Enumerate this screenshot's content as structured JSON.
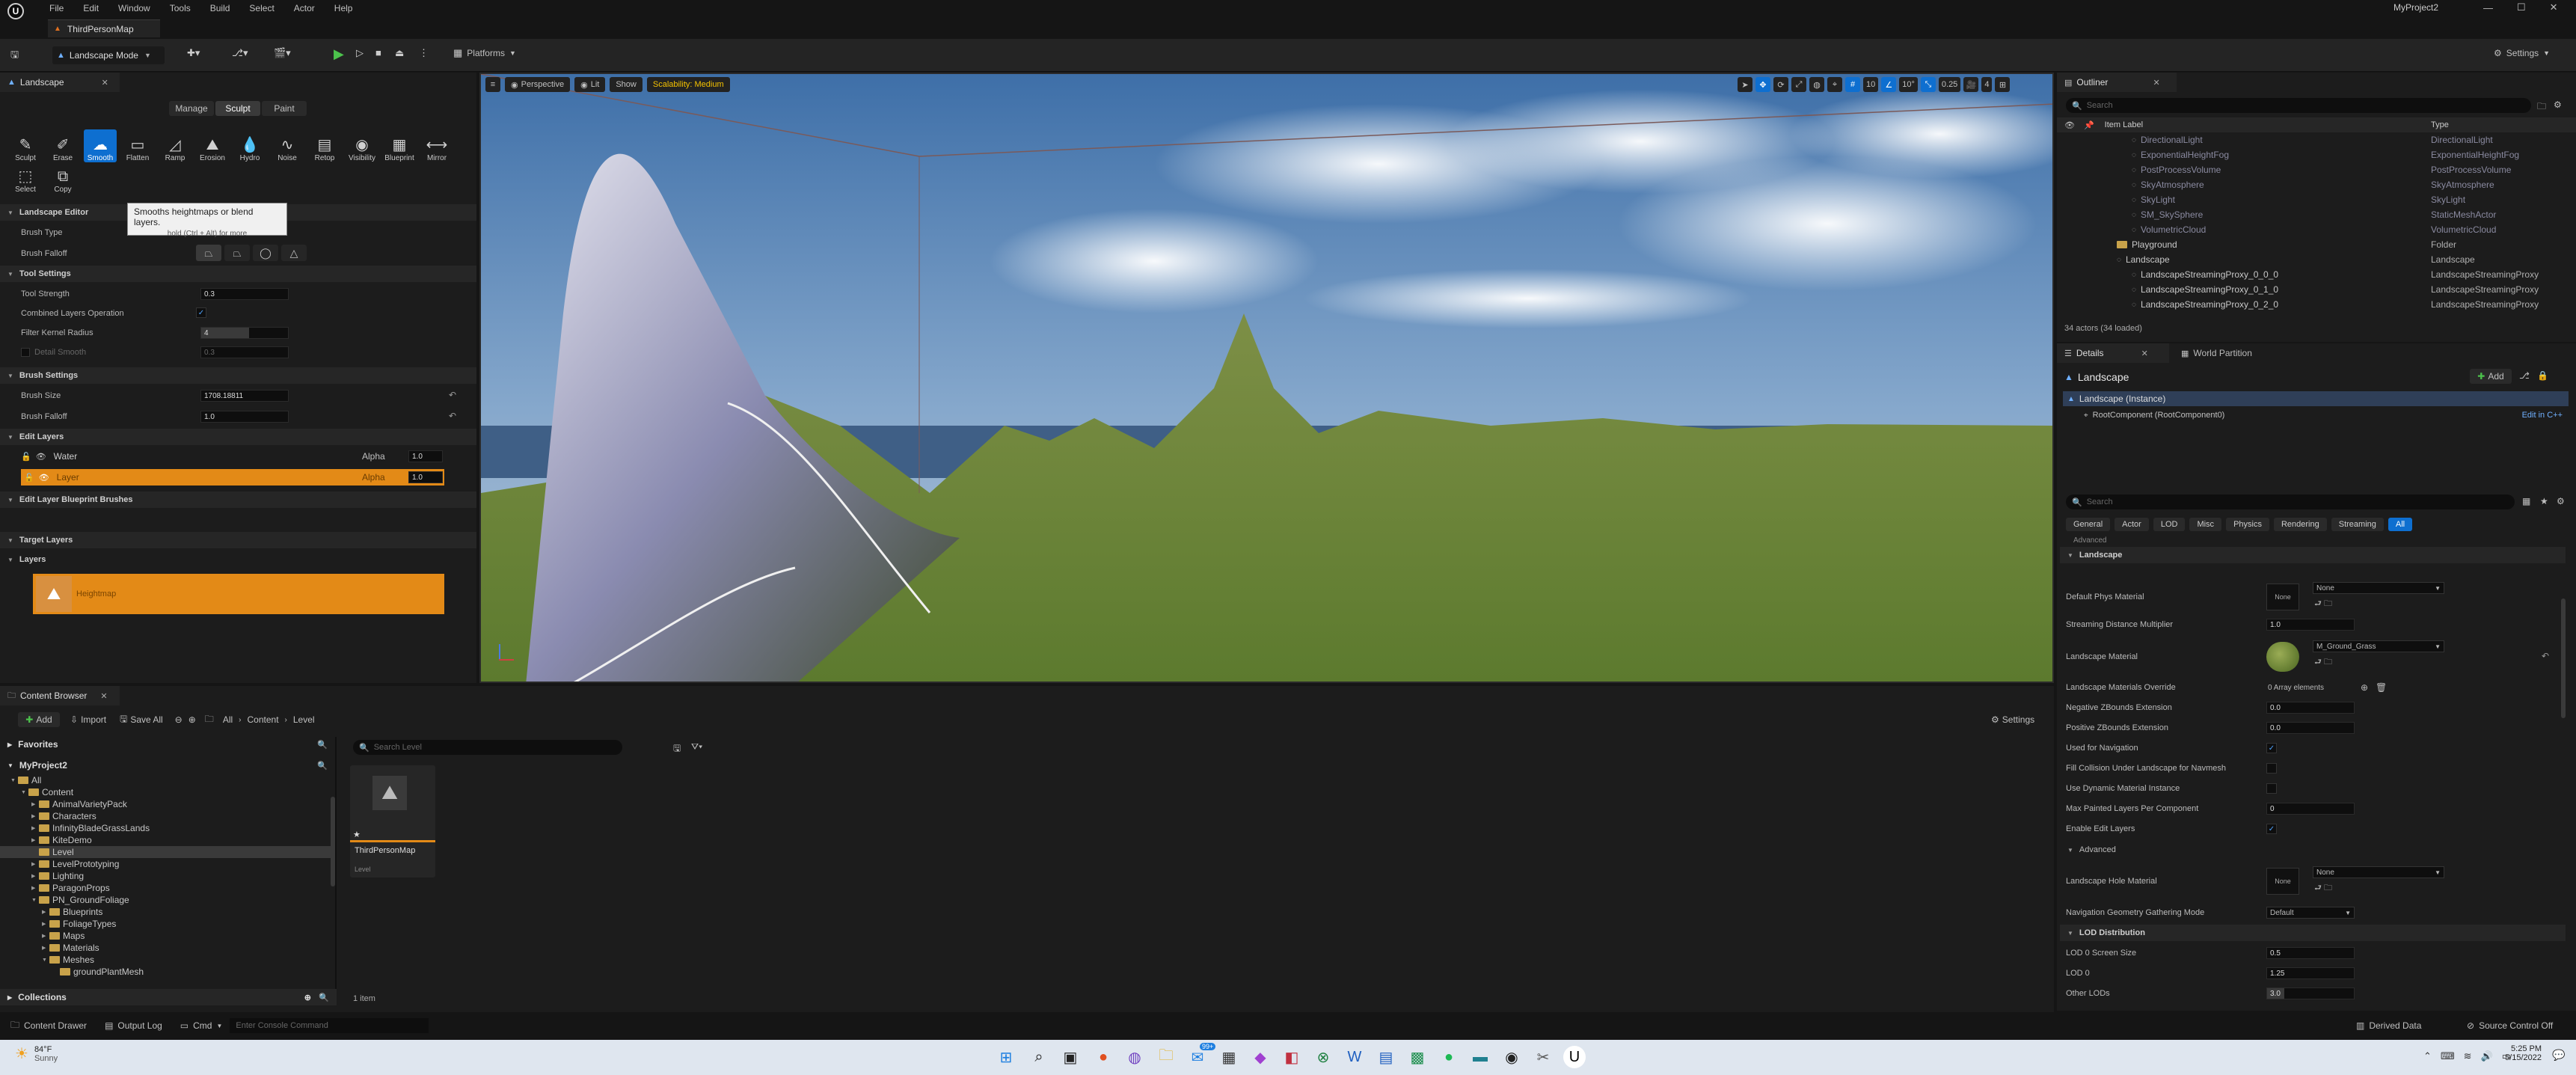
{
  "menu": {
    "items": [
      "File",
      "Edit",
      "Window",
      "Tools",
      "Build",
      "Select",
      "Actor",
      "Help"
    ],
    "project": "MyProject2"
  },
  "tab": {
    "level": "ThirdPersonMap"
  },
  "toolbar": {
    "mode": "Landscape Mode",
    "platforms": "Platforms",
    "settings": "Settings"
  },
  "landscape_panel": {
    "title": "Landscape",
    "modes": [
      "Manage",
      "Sculpt",
      "Paint"
    ],
    "tools": [
      "Sculpt",
      "Erase",
      "Smooth",
      "Flatten",
      "Ramp",
      "Erosion",
      "Hydro",
      "Noise",
      "Retop",
      "Visibility",
      "Blueprint",
      "Mirror",
      "Select",
      "Copy"
    ],
    "tooltip_title": "Smooths heightmaps or blend layers.",
    "tooltip_hint": "hold (Ctrl + Alt) for more",
    "sections": {
      "editor": "Landscape Editor",
      "brush_type": "Brush Type",
      "brush_falloff": "Brush Falloff",
      "tool_settings": "Tool Settings",
      "tool_strength": "Tool Strength",
      "tool_strength_val": "0.3",
      "combined": "Combined Layers Operation",
      "filter": "Filter Kernel Radius",
      "filter_val": "4",
      "detail": "Detail Smooth",
      "detail_val": "0.3",
      "brush_settings": "Brush Settings",
      "brush_size": "Brush Size",
      "brush_size_val": "1708.18811",
      "brush_falloff2": "Brush Falloff",
      "brush_falloff_val": "1.0",
      "edit_layers": "Edit Layers",
      "layer1": "Water",
      "layer1_alpha": "Alpha",
      "layer1_val": "1.0",
      "layer2": "Layer",
      "layer2_alpha": "Alpha",
      "layer2_val": "1.0",
      "bp_brushes": "Edit Layer Blueprint Brushes",
      "target_layers": "Target Layers",
      "layers": "Layers",
      "heightmap": "Heightmap"
    }
  },
  "viewport": {
    "perspective": "Perspective",
    "lit": "Lit",
    "show": "Show",
    "scalability": "Scalability: Medium",
    "grid": "10",
    "angle": "10°",
    "scale": "0.25",
    "cam": "4"
  },
  "outliner": {
    "title": "Outliner",
    "search": "Search",
    "col_label": "Item Label",
    "col_type": "Type",
    "rows": [
      {
        "label": "DirectionalLight",
        "type": "DirectionalLight"
      },
      {
        "label": "ExponentialHeightFog",
        "type": "ExponentialHeightFog"
      },
      {
        "label": "PostProcessVolume",
        "type": "PostProcessVolume"
      },
      {
        "label": "SkyAtmosphere",
        "type": "SkyAtmosphere"
      },
      {
        "label": "SkyLight",
        "type": "SkyLight"
      },
      {
        "label": "SM_SkySphere",
        "type": "StaticMeshActor"
      },
      {
        "label": "VolumetricCloud",
        "type": "VolumetricCloud"
      },
      {
        "label": "Playground",
        "type": "Folder"
      },
      {
        "label": "Landscape",
        "type": "Landscape"
      },
      {
        "label": "LandscapeStreamingProxy_0_0_0",
        "type": "LandscapeStreamingProxy"
      },
      {
        "label": "LandscapeStreamingProxy_0_1_0",
        "type": "LandscapeStreamingProxy"
      },
      {
        "label": "LandscapeStreamingProxy_0_2_0",
        "type": "LandscapeStreamingProxy"
      }
    ],
    "count": "34 actors (34 loaded)"
  },
  "details": {
    "tab1": "Details",
    "tab2": "World Partition",
    "name": "Landscape",
    "add": "Add",
    "instance": "Landscape (Instance)",
    "root": "RootComponent (RootComponent0)",
    "edit_cpp": "Edit in C++",
    "search": "Search",
    "filters": [
      "General",
      "Actor",
      "LOD",
      "Misc",
      "Physics",
      "Rendering",
      "Streaming",
      "All"
    ],
    "advanced_top": "Advanced",
    "landscape_sec": "Landscape",
    "phys_mat": "Default Phys Material",
    "none": "None",
    "stream_mult": "Streaming Distance Multiplier",
    "stream_mult_val": "1.0",
    "land_mat": "Landscape Material",
    "land_mat_val": "M_Ground_Grass",
    "mat_override": "Landscape Materials Override",
    "mat_override_val": "0 Array elements",
    "neg_z": "Negative ZBounds Extension",
    "neg_z_val": "0.0",
    "pos_z": "Positive ZBounds Extension",
    "pos_z_val": "0.0",
    "nav": "Used for Navigation",
    "fill_coll": "Fill Collision Under Landscape for Navmesh",
    "dyn_mat": "Use Dynamic Material Instance",
    "max_painted": "Max Painted Layers Per Component",
    "max_painted_val": "0",
    "enable_edit": "Enable Edit Layers",
    "advanced": "Advanced",
    "hole_mat": "Landscape Hole Material",
    "nav_geo": "Navigation Geometry Gathering Mode",
    "nav_geo_val": "Default",
    "lod_dist": "LOD Distribution",
    "lod0_size": "LOD 0 Screen Size",
    "lod0_size_val": "0.5",
    "lod0": "LOD 0",
    "lod0_val": "1.25",
    "other": "Other LODs",
    "other_val": "3.0"
  },
  "content_browser": {
    "title": "Content Browser",
    "add": "Add",
    "import": "Import",
    "save_all": "Save All",
    "crumbs": [
      "All",
      "Content",
      "Level"
    ],
    "settings": "Settings",
    "favorites": "Favorites",
    "project": "MyProject2",
    "search": "Search Level",
    "tree": [
      "All",
      "Content",
      "AnimalVarietyPack",
      "Characters",
      "InfinityBladeGrassLands",
      "KiteDemo",
      "Level",
      "LevelPrototyping",
      "Lighting",
      "ParagonProps",
      "PN_GroundFoliage",
      "Blueprints",
      "FoliageTypes",
      "Maps",
      "Materials",
      "Meshes",
      "groundPlantMesh"
    ],
    "asset": "ThirdPersonMap",
    "asset_type": "Level",
    "count": "1 item",
    "collections": "Collections"
  },
  "status": {
    "drawer": "Content Drawer",
    "output": "Output Log",
    "cmd": "Cmd",
    "console": "Enter Console Command",
    "derived": "Derived Data",
    "source": "Source Control Off"
  },
  "taskbar": {
    "temp": "84°F",
    "weather": "Sunny",
    "time": "5:25 PM",
    "date": "5/15/2022",
    "badge": "99+"
  }
}
